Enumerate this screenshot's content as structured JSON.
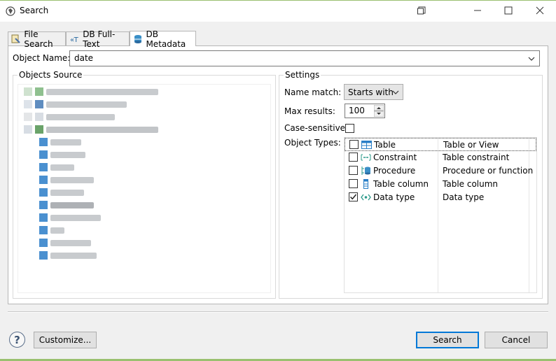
{
  "window": {
    "title": "Search",
    "minimize": "—",
    "maximize": "☐",
    "close": "✕"
  },
  "tabs": [
    {
      "label": "File Search",
      "icon": "file-search-icon",
      "active": false
    },
    {
      "label": "DB Full-Text",
      "icon": "full-text-icon",
      "active": false
    },
    {
      "label": "DB Metadata",
      "icon": "database-icon",
      "active": true
    }
  ],
  "object_name": {
    "label": "Object Name:",
    "value": "date"
  },
  "objects_source": {
    "label": "Objects Source"
  },
  "settings": {
    "label": "Settings",
    "name_match_label": "Name match:",
    "name_match_value": "Starts with",
    "max_results_label": "Max results:",
    "max_results_value": "100",
    "case_sensitive_label": "Case-sensitive:",
    "case_sensitive_checked": false,
    "object_types_label": "Object Types:",
    "object_types": [
      {
        "name": "Table",
        "description": "Table or View",
        "checked": false,
        "icon": "table-icon"
      },
      {
        "name": "Constraint",
        "description": "Table constraint",
        "checked": false,
        "icon": "constraint-icon"
      },
      {
        "name": "Procedure",
        "description": "Procedure or function",
        "checked": false,
        "icon": "procedure-icon"
      },
      {
        "name": "Table column",
        "description": "Table column",
        "checked": false,
        "icon": "column-icon"
      },
      {
        "name": "Data type",
        "description": "Data type",
        "checked": true,
        "icon": "data-type-icon"
      }
    ]
  },
  "buttons": {
    "help": "?",
    "customize": "Customize...",
    "search": "Search",
    "cancel": "Cancel"
  },
  "colors": {
    "accent": "#0078d7",
    "statusbar": "#9ac070"
  }
}
